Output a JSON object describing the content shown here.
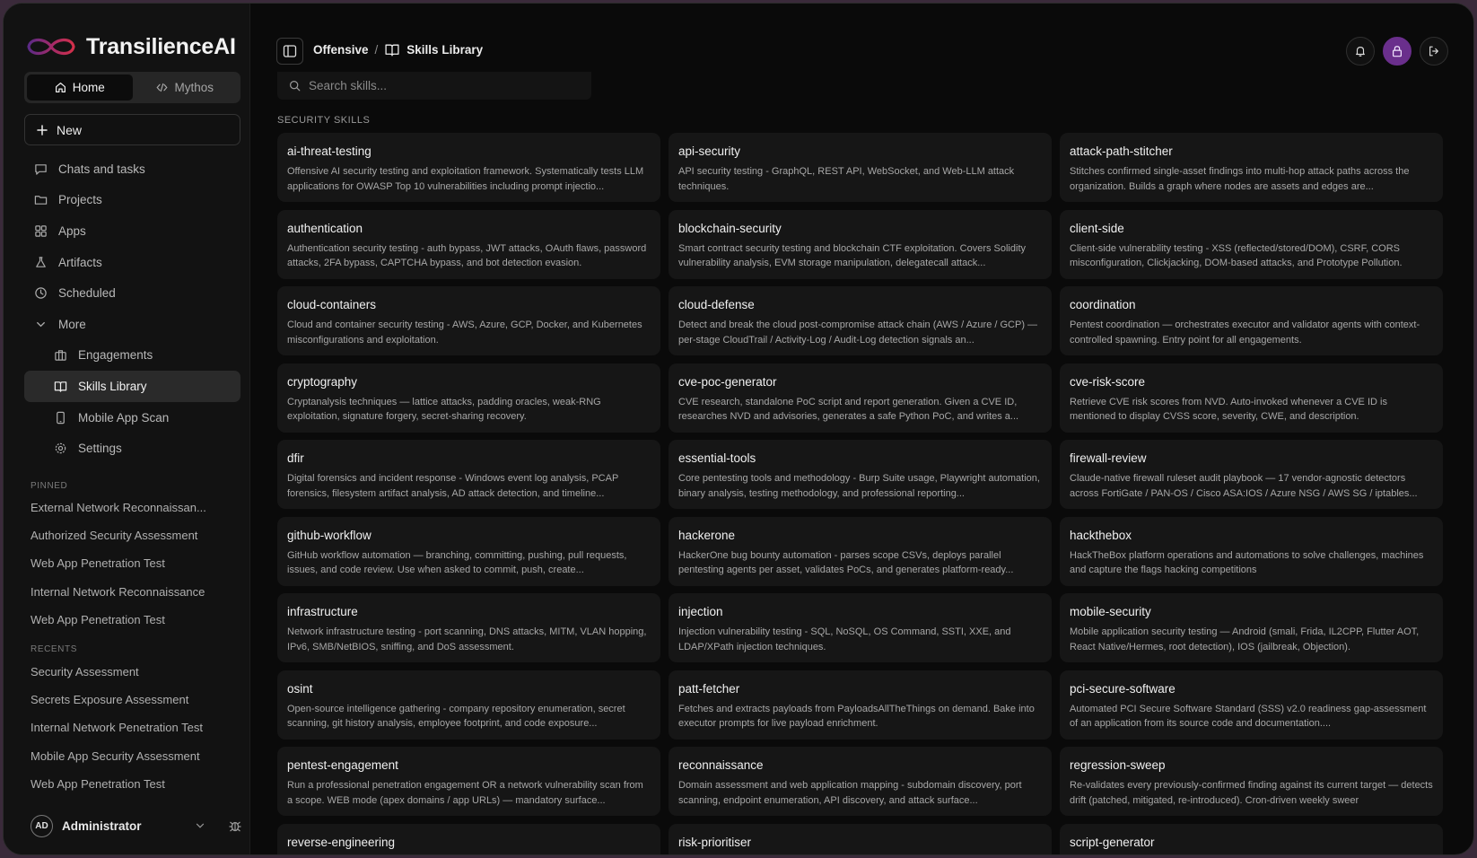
{
  "brand": {
    "name": "TransilienceAI"
  },
  "mode_switch": {
    "home": "Home",
    "mythos": "Mythos"
  },
  "new_label": "New",
  "nav": {
    "chats": "Chats and tasks",
    "projects": "Projects",
    "apps": "Apps",
    "artifacts": "Artifacts",
    "scheduled": "Scheduled",
    "more": "More",
    "engagements": "Engagements",
    "skills_library": "Skills Library",
    "mobile_app_scan": "Mobile App Scan",
    "settings": "Settings"
  },
  "pinned": {
    "label": "PINNED",
    "items": [
      "External Network Reconnaissan...",
      "Authorized Security Assessment",
      "Web App Penetration Test",
      "Internal Network Reconnaissance",
      "Web App Penetration Test"
    ]
  },
  "recents": {
    "label": "RECENTS",
    "items": [
      "Security Assessment",
      "Secrets Exposure Assessment",
      "Internal Network Penetration Test",
      "Mobile App Security Assessment",
      "Web App Penetration Test"
    ]
  },
  "user": {
    "initials": "AD",
    "name": "Administrator"
  },
  "breadcrumb": {
    "parent": "Offensive",
    "separator": "/",
    "current": "Skills Library"
  },
  "search": {
    "placeholder": "Search skills..."
  },
  "section_title": "SECURITY SKILLS",
  "colors": {
    "accent": "#6a2f8c",
    "background": "#0a0a0a",
    "card": "#161616"
  },
  "skills": [
    {
      "name": "ai-threat-testing",
      "desc": "Offensive AI security testing and exploitation framework. Systematically tests LLM applications for OWASP Top 10 vulnerabilities including prompt injectio..."
    },
    {
      "name": "api-security",
      "desc": "API security testing - GraphQL, REST API, WebSocket, and Web-LLM attack techniques."
    },
    {
      "name": "attack-path-stitcher",
      "desc": "Stitches confirmed single-asset findings into multi-hop attack paths across the organization. Builds a graph where nodes are assets and edges are..."
    },
    {
      "name": "authentication",
      "desc": "Authentication security testing - auth bypass, JWT attacks, OAuth flaws, password attacks, 2FA bypass, CAPTCHA bypass, and bot detection evasion."
    },
    {
      "name": "blockchain-security",
      "desc": "Smart contract security testing and blockchain CTF exploitation. Covers Solidity vulnerability analysis, EVM storage manipulation, delegatecall attack..."
    },
    {
      "name": "client-side",
      "desc": "Client-side vulnerability testing - XSS (reflected/stored/DOM), CSRF, CORS misconfiguration, Clickjacking, DOM-based attacks, and Prototype Pollution."
    },
    {
      "name": "cloud-containers",
      "desc": "Cloud and container security testing - AWS, Azure, GCP, Docker, and Kubernetes misconfigurations and exploitation."
    },
    {
      "name": "cloud-defense",
      "desc": "Detect and break the cloud post-compromise attack chain (AWS / Azure / GCP) — per-stage CloudTrail / Activity-Log / Audit-Log detection signals an..."
    },
    {
      "name": "coordination",
      "desc": "Pentest coordination — orchestrates executor and validator agents with context-controlled spawning. Entry point for all engagements."
    },
    {
      "name": "cryptography",
      "desc": "Cryptanalysis techniques — lattice attacks, padding oracles, weak-RNG exploitation, signature forgery, secret-sharing recovery."
    },
    {
      "name": "cve-poc-generator",
      "desc": "CVE research, standalone PoC script and report generation. Given a CVE ID, researches NVD and advisories, generates a safe Python PoC, and writes a..."
    },
    {
      "name": "cve-risk-score",
      "desc": "Retrieve CVE risk scores from NVD. Auto-invoked whenever a CVE ID is mentioned to display CVSS score, severity, CWE, and description."
    },
    {
      "name": "dfir",
      "desc": "Digital forensics and incident response - Windows event log analysis, PCAP forensics, filesystem artifact analysis, AD attack detection, and timeline..."
    },
    {
      "name": "essential-tools",
      "desc": "Core pentesting tools and methodology - Burp Suite usage, Playwright automation, binary analysis, testing methodology, and professional reporting..."
    },
    {
      "name": "firewall-review",
      "desc": "Claude-native firewall ruleset audit playbook — 17 vendor-agnostic detectors across FortiGate / PAN-OS / Cisco ASA:IOS / Azure NSG / AWS SG / iptables..."
    },
    {
      "name": "github-workflow",
      "desc": "GitHub workflow automation — branching, committing, pushing, pull requests, issues, and code review. Use when asked to commit, push, create..."
    },
    {
      "name": "hackerone",
      "desc": "HackerOne bug bounty automation - parses scope CSVs, deploys parallel pentesting agents per asset, validates PoCs, and generates platform-ready..."
    },
    {
      "name": "hackthebox",
      "desc": "HackTheBox platform operations and automations to solve challenges, machines and capture the flags hacking competitions"
    },
    {
      "name": "infrastructure",
      "desc": "Network infrastructure testing - port scanning, DNS attacks, MITM, VLAN hopping, IPv6, SMB/NetBIOS, sniffing, and DoS assessment."
    },
    {
      "name": "injection",
      "desc": "Injection vulnerability testing - SQL, NoSQL, OS Command, SSTI, XXE, and LDAP/XPath injection techniques."
    },
    {
      "name": "mobile-security",
      "desc": "Mobile application security testing — Android (smali, Frida, IL2CPP, Flutter AOT, React Native/Hermes, root detection), IOS (jailbreak, Objection)."
    },
    {
      "name": "osint",
      "desc": "Open-source intelligence gathering - company repository enumeration, secret scanning, git history analysis, employee footprint, and code exposure..."
    },
    {
      "name": "patt-fetcher",
      "desc": "Fetches and extracts payloads from PayloadsAllTheThings on demand. Bake into executor prompts for live payload enrichment."
    },
    {
      "name": "pci-secure-software",
      "desc": "Automated PCI Secure Software Standard (SSS) v2.0 readiness gap-assessment of an application from its source code and documentation...."
    },
    {
      "name": "pentest-engagement",
      "desc": "Run a professional penetration engagement OR a network vulnerability scan from a scope. WEB mode (apex domains / app URLs) — mandatory surface..."
    },
    {
      "name": "reconnaissance",
      "desc": "Domain assessment and web application mapping - subdomain discovery, port scanning, endpoint enumeration, API discovery, and attack surface..."
    },
    {
      "name": "regression-sweep",
      "desc": "Re-validates every previously-confirmed finding against its current target — detects drift (patched, mitigated, re-introduced). Cron-driven weekly sweer"
    },
    {
      "name": "reverse-engineering",
      "desc": ""
    },
    {
      "name": "risk-prioritiser",
      "desc": ""
    },
    {
      "name": "script-generator",
      "desc": ""
    }
  ]
}
